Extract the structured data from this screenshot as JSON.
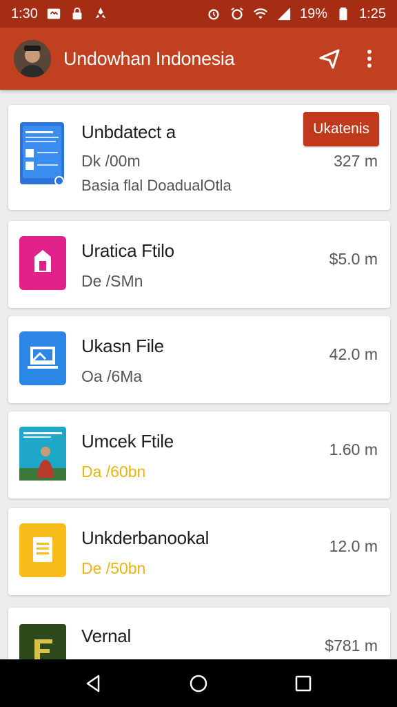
{
  "status_bar": {
    "time_left": "1:30",
    "battery": "19%",
    "time_right": "1:25"
  },
  "app_bar": {
    "title": "Undowhan Indonesia",
    "send_icon": "send-icon",
    "menu_icon": "more-vert-icon"
  },
  "items": [
    {
      "title": "Unbdatect a",
      "sub": "Dk /00m",
      "desc": "Basia flal DoadualOtla",
      "size": "327 m",
      "button": "Ukatenis"
    },
    {
      "title": "Uratica Ftilo",
      "sub": "De /SMn",
      "size": "$5.0 m"
    },
    {
      "title": "Ukasn File",
      "sub": "Oa /6Ma",
      "size": "42.0 m"
    },
    {
      "title": "Umcek Ftile",
      "sub": "Da /60bn",
      "size": "1.60 m"
    },
    {
      "title": "Unkderbanookal",
      "sub": "De /50bn",
      "size": "12.0 m"
    },
    {
      "title": "Vernal",
      "sub": "",
      "size": "$781 m"
    }
  ],
  "colors": {
    "status_bar": "#a52d14",
    "app_bar": "#c0401f",
    "accent_button": "#c0391b",
    "highlight_text": "#e8b410"
  }
}
